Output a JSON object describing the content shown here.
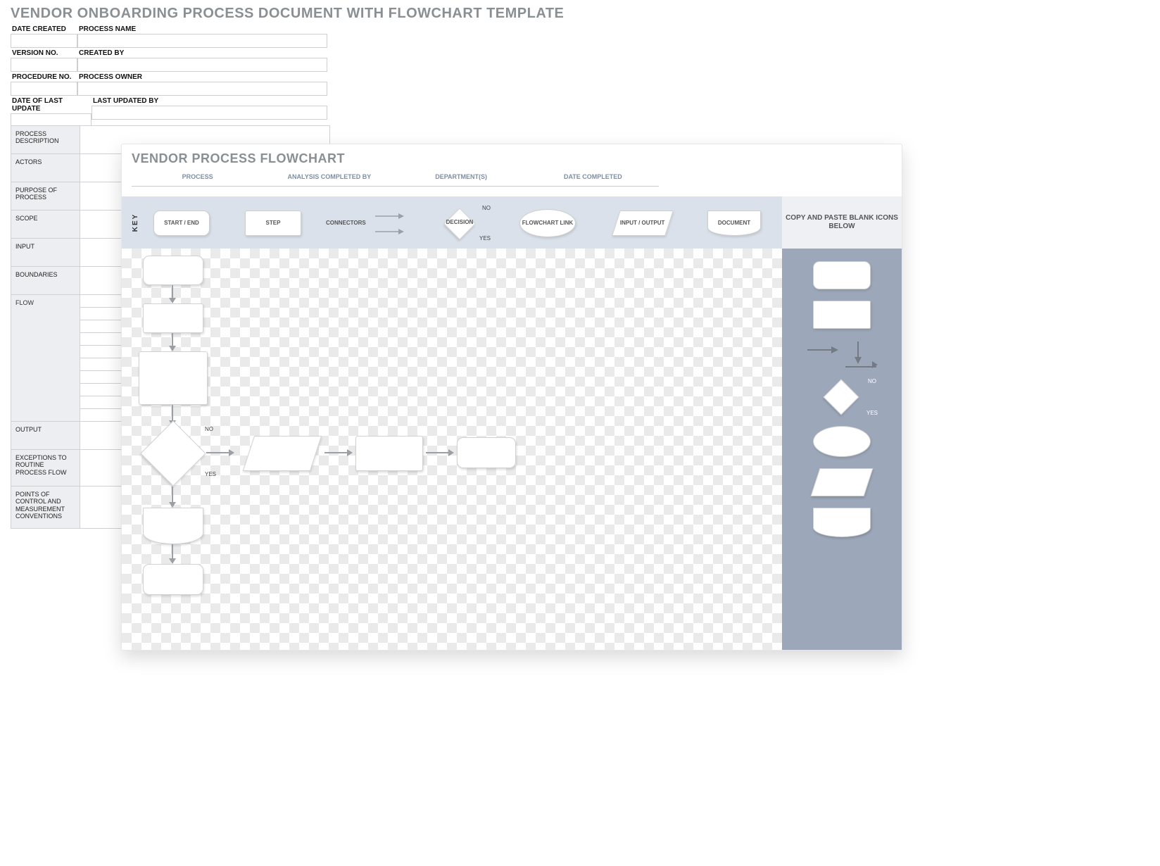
{
  "title": "VENDOR ONBOARDING  PROCESS DOCUMENT  WITH FLOWCHART TEMPLATE",
  "header_fields": [
    {
      "label": "DATE CREATED",
      "size": "sm",
      "value": ""
    },
    {
      "label": "PROCESS NAME",
      "size": "lg",
      "value": ""
    },
    {
      "label": "VERSION NO.",
      "size": "sm",
      "value": ""
    },
    {
      "label": "CREATED BY",
      "size": "lg",
      "value": ""
    },
    {
      "label": "PROCEDURE NO.",
      "size": "sm",
      "value": ""
    },
    {
      "label": "PROCESS OWNER",
      "size": "lg",
      "value": ""
    },
    {
      "label": "DATE OF LAST UPDATE",
      "size": "sm",
      "value": ""
    },
    {
      "label": "LAST UPDATED BY",
      "size": "lg",
      "value": ""
    }
  ],
  "detail_rows": [
    {
      "label": "PROCESS DESCRIPTION"
    },
    {
      "label": "ACTORS"
    },
    {
      "label": "PURPOSE OF PROCESS"
    },
    {
      "label": "SCOPE"
    },
    {
      "label": "INPUT"
    },
    {
      "label": "BOUNDARIES"
    }
  ],
  "flow_label": "FLOW",
  "flow_sub_rows": 10,
  "detail_rows_after": [
    {
      "label": "OUTPUT"
    },
    {
      "label": "EXCEPTIONS TO ROUTINE PROCESS FLOW"
    },
    {
      "label": "POINTS OF CONTROL AND MEASUREMENT CONVENTIONS"
    }
  ],
  "flowchart": {
    "title": "VENDOR PROCESS FLOWCHART",
    "meta_headers": [
      "PROCESS",
      "ANALYSIS COMPLETED BY",
      "DEPARTMENT(S)",
      "DATE COMPLETED"
    ],
    "key_label": "KEY",
    "key_items": [
      "START / END",
      "STEP",
      "CONNECTORS",
      "DECISION",
      "FLOWCHART LINK",
      "INPUT / OUTPUT",
      "DOCUMENT"
    ],
    "decision_no": "NO",
    "decision_yes": "YES",
    "copy_text": "COPY AND PASTE BLANK ICONS BELOW"
  }
}
